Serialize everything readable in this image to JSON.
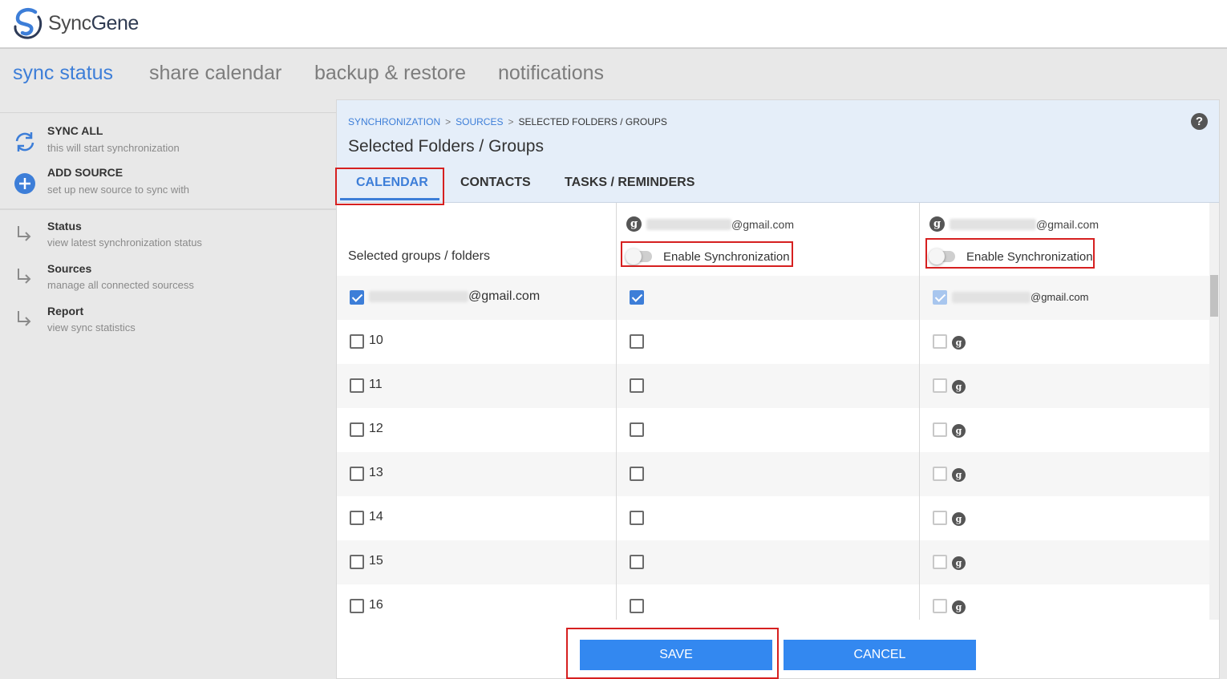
{
  "app": {
    "name_light": "Sync",
    "name_bold": "Gene"
  },
  "topnav": [
    "sync status",
    "share calendar",
    "backup & restore",
    "notifications"
  ],
  "sidebar": {
    "actions": [
      {
        "title": "SYNC ALL",
        "subtitle": "this will start synchronization",
        "icon": "refresh-icon"
      },
      {
        "title": "ADD SOURCE",
        "subtitle": "set up new source to sync with",
        "icon": "plus-circle-icon"
      }
    ],
    "links": [
      {
        "title": "Status",
        "subtitle": "view latest synchronization status"
      },
      {
        "title": "Sources",
        "subtitle": "manage all connected sourcess"
      },
      {
        "title": "Report",
        "subtitle": "view sync statistics"
      }
    ]
  },
  "breadcrumb": [
    "SYNCHRONIZATION",
    "SOURCES",
    "SELECTED FOLDERS / GROUPS"
  ],
  "title": "Selected Folders / Groups",
  "help": "?",
  "tabs": [
    "CALENDAR",
    "CONTACTS",
    "TASKS / REMINDERS"
  ],
  "group_column_label": "Selected groups / folders",
  "accounts": [
    {
      "email_suffix": "@gmail.com",
      "toggle_label": "Enable Synchronization"
    },
    {
      "email_suffix": "@gmail.com",
      "toggle_label": "Enable Synchronization"
    }
  ],
  "rows": [
    {
      "label": "@gmail.com",
      "col1": true,
      "col2": true,
      "col2_label": "@gmail.com"
    },
    {
      "label": "10",
      "col1": false,
      "col2": false
    },
    {
      "label": "11",
      "col1": false,
      "col2": false
    },
    {
      "label": "12",
      "col1": false,
      "col2": false
    },
    {
      "label": "13",
      "col1": false,
      "col2": false
    },
    {
      "label": "14",
      "col1": false,
      "col2": false
    },
    {
      "label": "15",
      "col1": false,
      "col2": false
    },
    {
      "label": "16",
      "col1": false,
      "col2": false
    }
  ],
  "buttons": {
    "save": "SAVE",
    "cancel": "CANCEL"
  },
  "colors": {
    "accent": "#3d7ed8",
    "button": "#3388f0",
    "highlight": "#d62020"
  }
}
